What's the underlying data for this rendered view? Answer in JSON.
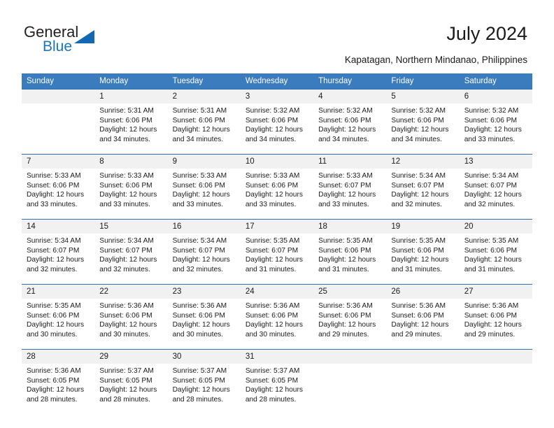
{
  "brand": {
    "name_top": "General",
    "name_bottom": "Blue",
    "accent_color": "#1a75bb",
    "triangle_color": "#1268b3"
  },
  "header": {
    "title": "July 2024",
    "location": "Kapatagan, Northern Mindanao, Philippines"
  },
  "theme": {
    "header_row_bg": "#3b7cbe",
    "header_row_text": "#ffffff",
    "daynum_bg": "#f1f1f1",
    "week_divider": "#2f6fae"
  },
  "calendar": {
    "weekday_headers": [
      "Sunday",
      "Monday",
      "Tuesday",
      "Wednesday",
      "Thursday",
      "Friday",
      "Saturday"
    ],
    "weeks": [
      [
        {
          "day": "",
          "sunrise": "",
          "sunset": "",
          "daylight_line1": "",
          "daylight_line2": ""
        },
        {
          "day": "1",
          "sunrise": "Sunrise: 5:31 AM",
          "sunset": "Sunset: 6:06 PM",
          "daylight_line1": "Daylight: 12 hours",
          "daylight_line2": "and 34 minutes."
        },
        {
          "day": "2",
          "sunrise": "Sunrise: 5:31 AM",
          "sunset": "Sunset: 6:06 PM",
          "daylight_line1": "Daylight: 12 hours",
          "daylight_line2": "and 34 minutes."
        },
        {
          "day": "3",
          "sunrise": "Sunrise: 5:32 AM",
          "sunset": "Sunset: 6:06 PM",
          "daylight_line1": "Daylight: 12 hours",
          "daylight_line2": "and 34 minutes."
        },
        {
          "day": "4",
          "sunrise": "Sunrise: 5:32 AM",
          "sunset": "Sunset: 6:06 PM",
          "daylight_line1": "Daylight: 12 hours",
          "daylight_line2": "and 34 minutes."
        },
        {
          "day": "5",
          "sunrise": "Sunrise: 5:32 AM",
          "sunset": "Sunset: 6:06 PM",
          "daylight_line1": "Daylight: 12 hours",
          "daylight_line2": "and 34 minutes."
        },
        {
          "day": "6",
          "sunrise": "Sunrise: 5:32 AM",
          "sunset": "Sunset: 6:06 PM",
          "daylight_line1": "Daylight: 12 hours",
          "daylight_line2": "and 33 minutes."
        }
      ],
      [
        {
          "day": "7",
          "sunrise": "Sunrise: 5:33 AM",
          "sunset": "Sunset: 6:06 PM",
          "daylight_line1": "Daylight: 12 hours",
          "daylight_line2": "and 33 minutes."
        },
        {
          "day": "8",
          "sunrise": "Sunrise: 5:33 AM",
          "sunset": "Sunset: 6:06 PM",
          "daylight_line1": "Daylight: 12 hours",
          "daylight_line2": "and 33 minutes."
        },
        {
          "day": "9",
          "sunrise": "Sunrise: 5:33 AM",
          "sunset": "Sunset: 6:06 PM",
          "daylight_line1": "Daylight: 12 hours",
          "daylight_line2": "and 33 minutes."
        },
        {
          "day": "10",
          "sunrise": "Sunrise: 5:33 AM",
          "sunset": "Sunset: 6:06 PM",
          "daylight_line1": "Daylight: 12 hours",
          "daylight_line2": "and 33 minutes."
        },
        {
          "day": "11",
          "sunrise": "Sunrise: 5:33 AM",
          "sunset": "Sunset: 6:07 PM",
          "daylight_line1": "Daylight: 12 hours",
          "daylight_line2": "and 33 minutes."
        },
        {
          "day": "12",
          "sunrise": "Sunrise: 5:34 AM",
          "sunset": "Sunset: 6:07 PM",
          "daylight_line1": "Daylight: 12 hours",
          "daylight_line2": "and 32 minutes."
        },
        {
          "day": "13",
          "sunrise": "Sunrise: 5:34 AM",
          "sunset": "Sunset: 6:07 PM",
          "daylight_line1": "Daylight: 12 hours",
          "daylight_line2": "and 32 minutes."
        }
      ],
      [
        {
          "day": "14",
          "sunrise": "Sunrise: 5:34 AM",
          "sunset": "Sunset: 6:07 PM",
          "daylight_line1": "Daylight: 12 hours",
          "daylight_line2": "and 32 minutes."
        },
        {
          "day": "15",
          "sunrise": "Sunrise: 5:34 AM",
          "sunset": "Sunset: 6:07 PM",
          "daylight_line1": "Daylight: 12 hours",
          "daylight_line2": "and 32 minutes."
        },
        {
          "day": "16",
          "sunrise": "Sunrise: 5:34 AM",
          "sunset": "Sunset: 6:07 PM",
          "daylight_line1": "Daylight: 12 hours",
          "daylight_line2": "and 32 minutes."
        },
        {
          "day": "17",
          "sunrise": "Sunrise: 5:35 AM",
          "sunset": "Sunset: 6:07 PM",
          "daylight_line1": "Daylight: 12 hours",
          "daylight_line2": "and 31 minutes."
        },
        {
          "day": "18",
          "sunrise": "Sunrise: 5:35 AM",
          "sunset": "Sunset: 6:06 PM",
          "daylight_line1": "Daylight: 12 hours",
          "daylight_line2": "and 31 minutes."
        },
        {
          "day": "19",
          "sunrise": "Sunrise: 5:35 AM",
          "sunset": "Sunset: 6:06 PM",
          "daylight_line1": "Daylight: 12 hours",
          "daylight_line2": "and 31 minutes."
        },
        {
          "day": "20",
          "sunrise": "Sunrise: 5:35 AM",
          "sunset": "Sunset: 6:06 PM",
          "daylight_line1": "Daylight: 12 hours",
          "daylight_line2": "and 31 minutes."
        }
      ],
      [
        {
          "day": "21",
          "sunrise": "Sunrise: 5:35 AM",
          "sunset": "Sunset: 6:06 PM",
          "daylight_line1": "Daylight: 12 hours",
          "daylight_line2": "and 30 minutes."
        },
        {
          "day": "22",
          "sunrise": "Sunrise: 5:36 AM",
          "sunset": "Sunset: 6:06 PM",
          "daylight_line1": "Daylight: 12 hours",
          "daylight_line2": "and 30 minutes."
        },
        {
          "day": "23",
          "sunrise": "Sunrise: 5:36 AM",
          "sunset": "Sunset: 6:06 PM",
          "daylight_line1": "Daylight: 12 hours",
          "daylight_line2": "and 30 minutes."
        },
        {
          "day": "24",
          "sunrise": "Sunrise: 5:36 AM",
          "sunset": "Sunset: 6:06 PM",
          "daylight_line1": "Daylight: 12 hours",
          "daylight_line2": "and 30 minutes."
        },
        {
          "day": "25",
          "sunrise": "Sunrise: 5:36 AM",
          "sunset": "Sunset: 6:06 PM",
          "daylight_line1": "Daylight: 12 hours",
          "daylight_line2": "and 29 minutes."
        },
        {
          "day": "26",
          "sunrise": "Sunrise: 5:36 AM",
          "sunset": "Sunset: 6:06 PM",
          "daylight_line1": "Daylight: 12 hours",
          "daylight_line2": "and 29 minutes."
        },
        {
          "day": "27",
          "sunrise": "Sunrise: 5:36 AM",
          "sunset": "Sunset: 6:06 PM",
          "daylight_line1": "Daylight: 12 hours",
          "daylight_line2": "and 29 minutes."
        }
      ],
      [
        {
          "day": "28",
          "sunrise": "Sunrise: 5:36 AM",
          "sunset": "Sunset: 6:05 PM",
          "daylight_line1": "Daylight: 12 hours",
          "daylight_line2": "and 28 minutes."
        },
        {
          "day": "29",
          "sunrise": "Sunrise: 5:37 AM",
          "sunset": "Sunset: 6:05 PM",
          "daylight_line1": "Daylight: 12 hours",
          "daylight_line2": "and 28 minutes."
        },
        {
          "day": "30",
          "sunrise": "Sunrise: 5:37 AM",
          "sunset": "Sunset: 6:05 PM",
          "daylight_line1": "Daylight: 12 hours",
          "daylight_line2": "and 28 minutes."
        },
        {
          "day": "31",
          "sunrise": "Sunrise: 5:37 AM",
          "sunset": "Sunset: 6:05 PM",
          "daylight_line1": "Daylight: 12 hours",
          "daylight_line2": "and 28 minutes."
        },
        {
          "day": "",
          "sunrise": "",
          "sunset": "",
          "daylight_line1": "",
          "daylight_line2": ""
        },
        {
          "day": "",
          "sunrise": "",
          "sunset": "",
          "daylight_line1": "",
          "daylight_line2": ""
        },
        {
          "day": "",
          "sunrise": "",
          "sunset": "",
          "daylight_line1": "",
          "daylight_line2": ""
        }
      ]
    ]
  }
}
